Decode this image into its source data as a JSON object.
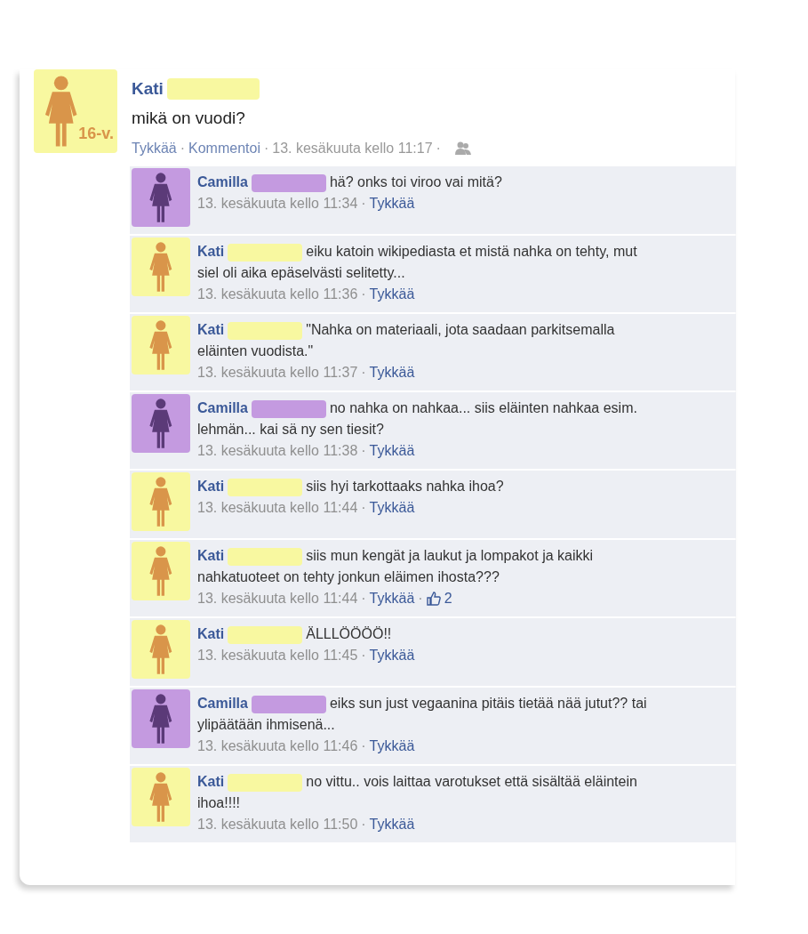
{
  "separator": "·",
  "post": {
    "author": "Kati",
    "avatar": {
      "color": "#f8f8a0",
      "figure": {
        "color": "#d9954a"
      },
      "badge": "16-v."
    },
    "text": "mikä on vuodi?",
    "actions": [
      {
        "label": "Tykkää",
        "kind": "link"
      },
      {
        "label": "Kommentoi",
        "kind": "link"
      },
      {
        "label": "13. kesäkuuta kello 11:17",
        "kind": "time"
      }
    ]
  },
  "comments": [
    {
      "author": "Camilla",
      "color": "#c49ae0",
      "figure": {
        "color": "#5b3a78"
      },
      "text": "hä? onks toi viroo vai mitä?",
      "time": "13. kesäkuuta kello 11:34",
      "like": "Tykkää"
    },
    {
      "author": "Kati",
      "color": "#f8f8a0",
      "figure": {
        "color": "#d9954a"
      },
      "text": "eiku katoin wikipediasta et mistä nahka on tehty, mut siel oli aika epäselvästi selitetty...",
      "time": "13. kesäkuuta kello 11:36",
      "like": "Tykkää"
    },
    {
      "author": "Kati",
      "color": "#f8f8a0",
      "figure": {
        "color": "#d9954a"
      },
      "text": "\"Nahka on materiaali, jota saadaan parkitsemalla eläinten vuodista.\"",
      "time": "13. kesäkuuta kello 11:37",
      "like": "Tykkää"
    },
    {
      "author": "Camilla",
      "color": "#c49ae0",
      "figure": {
        "color": "#5b3a78"
      },
      "text": "no nahka on nahkaa... siis eläinten nahkaa esim. lehmän... kai sä ny sen tiesit?",
      "time": "13. kesäkuuta kello 11:38",
      "like": "Tykkää"
    },
    {
      "author": "Kati",
      "color": "#f8f8a0",
      "figure": {
        "color": "#d9954a"
      },
      "text": "siis hyi tarkottaaks nahka ihoa?",
      "time": "13. kesäkuuta kello 11:44",
      "like": "Tykkää"
    },
    {
      "author": "Kati",
      "color": "#f8f8a0",
      "figure": {
        "color": "#d9954a"
      },
      "text": "siis mun kengät ja laukut ja lompakot ja kaikki nahkatuoteet on tehty jonkun eläimen ihosta???",
      "time": "13. kesäkuuta kello 11:44",
      "like": "Tykkää",
      "likes": "2"
    },
    {
      "author": "Kati",
      "color": "#f8f8a0",
      "figure": {
        "color": "#d9954a"
      },
      "text": "ÄLLLÖÖÖÖ!!",
      "time": "13. kesäkuuta kello 11:45",
      "like": "Tykkää"
    },
    {
      "author": "Camilla",
      "color": "#c49ae0",
      "figure": {
        "color": "#5b3a78"
      },
      "text": "eiks sun just vegaanina pitäis tietää nää jutut?? tai ylipäätään ihmisenä...",
      "time": "13. kesäkuuta kello 11:46",
      "like": "Tykkää"
    },
    {
      "author": "Kati",
      "color": "#f8f8a0",
      "figure": {
        "color": "#d9954a"
      },
      "text": "no vittu.. vois laittaa varotukset että sisältää eläintein ihoa!!!!",
      "time": "13. kesäkuuta kello 11:50",
      "like": "Tykkää"
    }
  ]
}
